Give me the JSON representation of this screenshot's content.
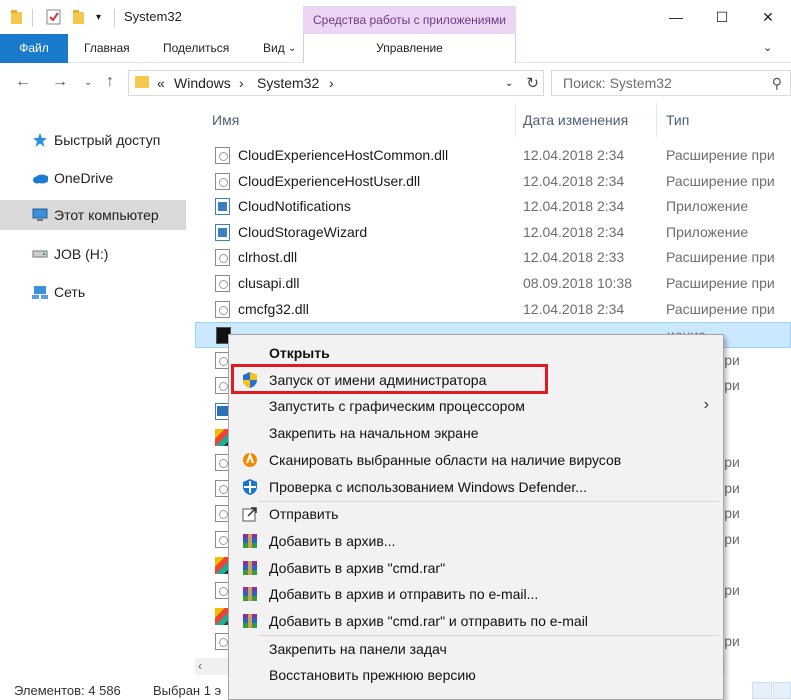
{
  "window": {
    "title": "System32",
    "contextual_group": "Средства работы с приложениями",
    "min_label": "—",
    "max_label": "☐",
    "close_label": "✕"
  },
  "ribbon": {
    "file": "Файл",
    "home": "Главная",
    "share": "Поделиться",
    "view": "Вид",
    "manage": "Управление"
  },
  "address": {
    "chevron": "«",
    "crumb1": "Windows",
    "crumb2": "System32",
    "arrow": "›",
    "search_placeholder": "Поиск: System32"
  },
  "sidebar": {
    "items": [
      {
        "label": "Быстрый доступ",
        "icon": "star-icon"
      },
      {
        "label": "OneDrive",
        "icon": "cloud-icon"
      },
      {
        "label": "Этот компьютер",
        "icon": "computer-icon"
      },
      {
        "label": "JOB (H:)",
        "icon": "drive-icon"
      },
      {
        "label": "Сеть",
        "icon": "network-icon"
      }
    ]
  },
  "columns": {
    "name": "Имя",
    "date": "Дата изменения",
    "type": "Тип"
  },
  "files": [
    {
      "name": "CloudExperienceHostCommon.dll",
      "date": "12.04.2018 2:34",
      "type": "Расширение при",
      "icon": "dll"
    },
    {
      "name": "CloudExperienceHostUser.dll",
      "date": "12.04.2018 2:34",
      "type": "Расширение при",
      "icon": "dll"
    },
    {
      "name": "CloudNotifications",
      "date": "12.04.2018 2:34",
      "type": "Приложение",
      "icon": "app"
    },
    {
      "name": "CloudStorageWizard",
      "date": "12.04.2018 2:34",
      "type": "Приложение",
      "icon": "app"
    },
    {
      "name": "clrhost.dll",
      "date": "12.04.2018 2:33",
      "type": "Расширение при",
      "icon": "dll"
    },
    {
      "name": "clusapi.dll",
      "date": "08.09.2018 10:38",
      "type": "Расширение при",
      "icon": "dll"
    },
    {
      "name": "cmcfg32.dll",
      "date": "12.04.2018 2:34",
      "type": "Расширение при",
      "icon": "dll"
    },
    {
      "name": "",
      "date": "",
      "type": "иение",
      "icon": "cmd"
    },
    {
      "name": "",
      "date": "",
      "type": "ирение при",
      "icon": "dll"
    },
    {
      "name": "",
      "date": "",
      "type": "ирение при",
      "icon": "dll"
    },
    {
      "name": "",
      "date": "",
      "type": "иение",
      "icon": "blue"
    },
    {
      "name": "",
      "date": "",
      "type": "иение",
      "icon": "colorful"
    },
    {
      "name": "",
      "date": "",
      "type": "ирение при",
      "icon": "dll"
    },
    {
      "name": "",
      "date": "",
      "type": "ирение при",
      "icon": "dll"
    },
    {
      "name": "",
      "date": "",
      "type": "ирение при",
      "icon": "dll"
    },
    {
      "name": "",
      "date": "",
      "type": "ирение при",
      "icon": "dll"
    },
    {
      "name": "",
      "date": "",
      "type": "иение",
      "icon": "colorful"
    },
    {
      "name": "",
      "date": "",
      "type": "ирение при",
      "icon": "dll"
    },
    {
      "name": "",
      "date": "",
      "type": "иение",
      "icon": "colorful"
    },
    {
      "name": "",
      "date": "",
      "type": "ирение при",
      "icon": "dll"
    }
  ],
  "status": {
    "count": "Элементов: 4 586",
    "selected": "Выбран 1 э"
  },
  "menu": {
    "items": [
      {
        "label": "Открыть",
        "bold": true,
        "icon": ""
      },
      {
        "label": "Запуск от имени администратора",
        "icon": "uac-shield-icon"
      },
      {
        "label": "Запустить с графическим процессором",
        "icon": "",
        "submenu": true
      },
      {
        "label": "Закрепить на начальном экране",
        "icon": ""
      },
      {
        "label": "Сканировать выбранные области на наличие вирусов",
        "icon": "avast-icon"
      },
      {
        "label": "Проверка с использованием Windows Defender...",
        "icon": "defender-icon"
      },
      {
        "label": "Отправить",
        "icon": "share-icon"
      },
      {
        "label": "Добавить в архив...",
        "icon": "winrar-icon"
      },
      {
        "label": "Добавить в архив \"cmd.rar\"",
        "icon": "winrar-icon"
      },
      {
        "label": "Добавить в архив и отправить по e-mail...",
        "icon": "winrar-icon"
      },
      {
        "label": "Добавить в архив \"cmd.rar\" и отправить по e-mail",
        "icon": "winrar-icon"
      },
      {
        "label": "Закрепить на панели задач",
        "icon": ""
      },
      {
        "label": "Восстановить прежнюю версию",
        "icon": ""
      }
    ]
  },
  "colors": {
    "accent": "#1979ca",
    "contextual": "#ecd5f2",
    "selection": "#cce8ff",
    "highlight": "#e11a22"
  }
}
